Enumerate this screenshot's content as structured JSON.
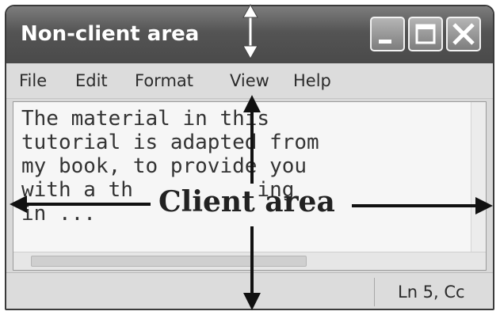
{
  "window": {
    "title": "Non-client area",
    "buttons": [
      "minimize-icon",
      "maximize-icon",
      "close-icon"
    ]
  },
  "menu": [
    "File",
    "Edit",
    "Format",
    "View",
    "Help"
  ],
  "editor": {
    "lines": [
      "The material in this",
      "tutorial is adapted from",
      "my book, to provide you",
      "with a th          ing",
      "in ..."
    ]
  },
  "status": {
    "position": "Ln 5, Cc"
  },
  "annotations": {
    "client_label": "Client area"
  }
}
